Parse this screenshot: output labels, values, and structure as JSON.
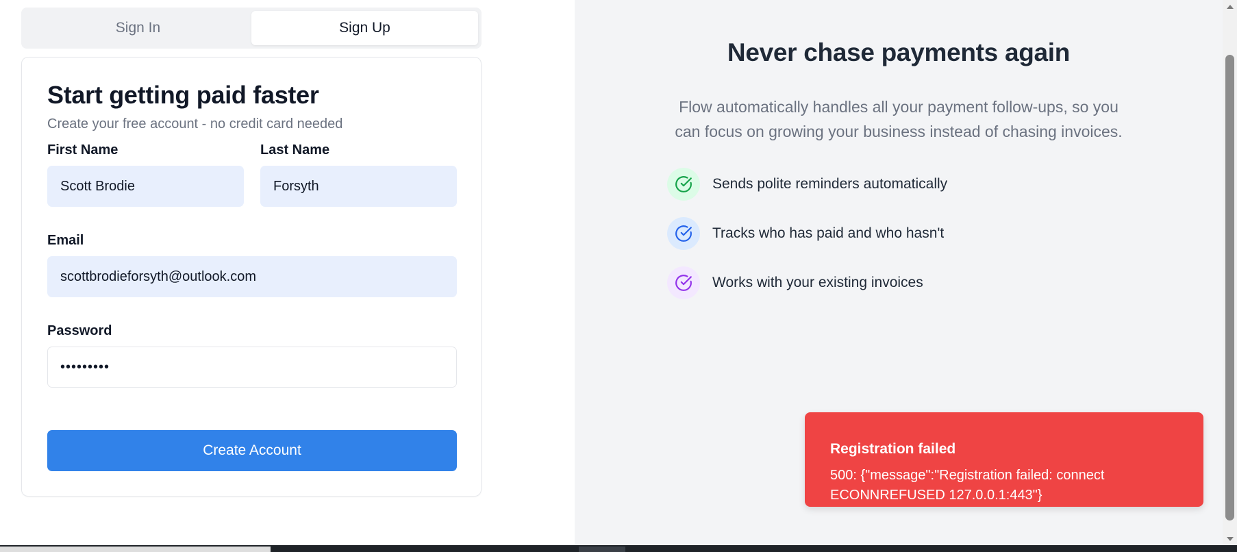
{
  "tabs": {
    "sign_in": "Sign In",
    "sign_up": "Sign Up"
  },
  "form": {
    "title": "Start getting paid faster",
    "subtitle": "Create your free account - no credit card needed",
    "first_name_label": "First Name",
    "first_name_value": "Scott Brodie",
    "last_name_label": "Last Name",
    "last_name_value": "Forsyth",
    "email_label": "Email",
    "email_value": "scottbrodieforsyth@outlook.com",
    "password_label": "Password",
    "password_value": "•••••••••",
    "submit_label": "Create Account"
  },
  "hero": {
    "title": "Never chase payments again",
    "description": "Flow automatically handles all your payment follow-ups, so you can focus on growing your business instead of chasing invoices.",
    "features": [
      {
        "text": "Sends polite reminders automatically",
        "icon": "check-circle-icon",
        "color": "#16a34a",
        "bg": "#dcfce7"
      },
      {
        "text": "Tracks who has paid and who hasn't",
        "icon": "check-circle-icon",
        "color": "#2563eb",
        "bg": "#dbeafe"
      },
      {
        "text": "Works with your existing invoices",
        "icon": "check-circle-icon",
        "color": "#9333ea",
        "bg": "#f3e8ff"
      }
    ]
  },
  "toast": {
    "title": "Registration failed",
    "message": "500: {\"message\":\"Registration failed: connect ECONNREFUSED 127.0.0.1:443\"}",
    "color": "#ef4444"
  },
  "colors": {
    "primary": "#3182e9",
    "input_autofill": "#e8effd",
    "panel_bg": "#f3f4f6"
  }
}
